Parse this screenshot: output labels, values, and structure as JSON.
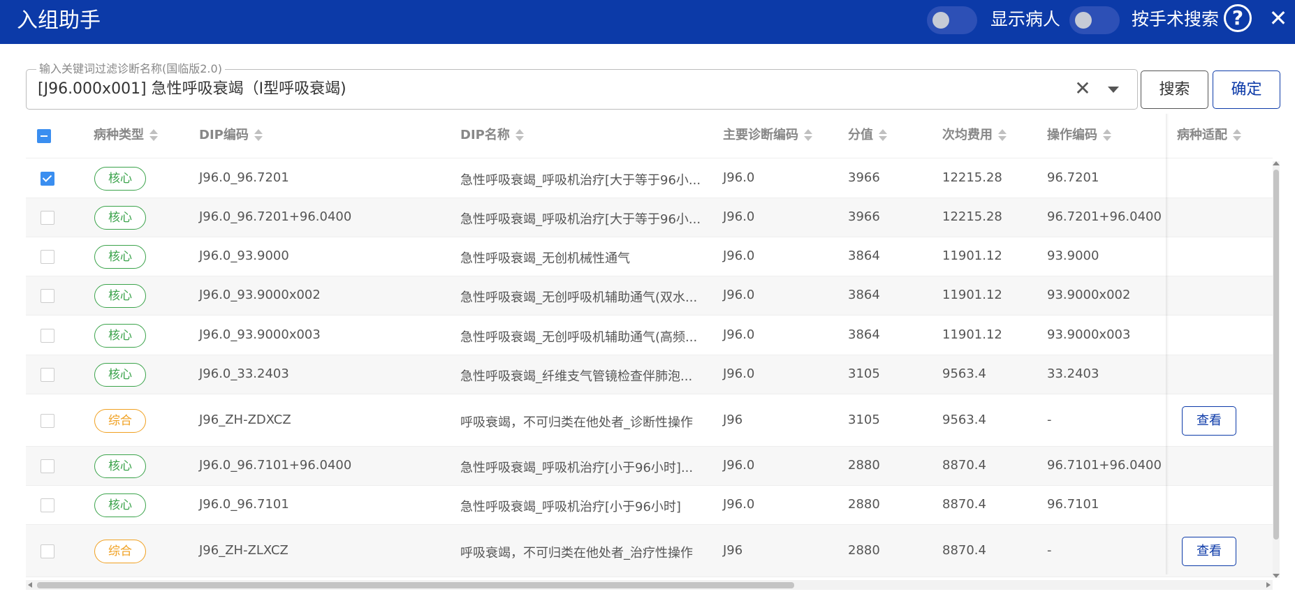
{
  "header": {
    "title": "入组助手",
    "toggle_show_patient_label": "显示病人",
    "toggle_search_by_surgery_label": "按手术搜索",
    "help_icon": "question-circle-icon",
    "close_icon": "close-icon"
  },
  "search": {
    "legend": "输入关键词过滤诊断名称(国临版2.0)",
    "value": "[J96.000x001] 急性呼吸衰竭（I型呼吸衰竭)",
    "search_button": "搜索",
    "confirm_button": "确定"
  },
  "table": {
    "columns": {
      "disease_type": "病种类型",
      "dip_code": "DIP编码",
      "dip_name": "DIP名称",
      "main_diag_code": "主要诊断编码",
      "score": "分值",
      "avg_cost": "次均费用",
      "op_code": "操作编码",
      "match": "病种适配"
    },
    "rows": [
      {
        "tag": "核心",
        "tag_type": "core",
        "checked": true,
        "dip_code": "J96.0_96.7201",
        "dip_name": "急性呼吸衰竭_呼吸机治疗[大于等于96小...",
        "diag": "J96.0",
        "score": "3966",
        "cost": "12215.28",
        "op": "96.7201",
        "view": ""
      },
      {
        "tag": "核心",
        "tag_type": "core",
        "checked": false,
        "dip_code": "J96.0_96.7201+96.0400",
        "dip_name": "急性呼吸衰竭_呼吸机治疗[大于等于96小...",
        "diag": "J96.0",
        "score": "3966",
        "cost": "12215.28",
        "op": "96.7201+96.0400",
        "view": ""
      },
      {
        "tag": "核心",
        "tag_type": "core",
        "checked": false,
        "dip_code": "J96.0_93.9000",
        "dip_name": "急性呼吸衰竭_无创机械性通气",
        "diag": "J96.0",
        "score": "3864",
        "cost": "11901.12",
        "op": "93.9000",
        "view": ""
      },
      {
        "tag": "核心",
        "tag_type": "core",
        "checked": false,
        "dip_code": "J96.0_93.9000x002",
        "dip_name": "急性呼吸衰竭_无创呼吸机辅助通气(双水...",
        "diag": "J96.0",
        "score": "3864",
        "cost": "11901.12",
        "op": "93.9000x002",
        "view": ""
      },
      {
        "tag": "核心",
        "tag_type": "core",
        "checked": false,
        "dip_code": "J96.0_93.9000x003",
        "dip_name": "急性呼吸衰竭_无创呼吸机辅助通气(高频...",
        "diag": "J96.0",
        "score": "3864",
        "cost": "11901.12",
        "op": "93.9000x003",
        "view": ""
      },
      {
        "tag": "核心",
        "tag_type": "core",
        "checked": false,
        "dip_code": "J96.0_33.2403",
        "dip_name": "急性呼吸衰竭_纤维支气管镜检查伴肺泡...",
        "diag": "J96.0",
        "score": "3105",
        "cost": "9563.4",
        "op": "33.2403",
        "view": ""
      },
      {
        "tag": "综合",
        "tag_type": "comp",
        "checked": false,
        "dip_code": "J96_ZH-ZDXCZ",
        "dip_name": "呼吸衰竭，不可归类在他处者_诊断性操作",
        "diag": "J96",
        "score": "3105",
        "cost": "9563.4",
        "op": "-",
        "view": "查看"
      },
      {
        "tag": "核心",
        "tag_type": "core",
        "checked": false,
        "dip_code": "J96.0_96.7101+96.0400",
        "dip_name": "急性呼吸衰竭_呼吸机治疗[小于96小时]...",
        "diag": "J96.0",
        "score": "2880",
        "cost": "8870.4",
        "op": "96.7101+96.0400",
        "view": ""
      },
      {
        "tag": "核心",
        "tag_type": "core",
        "checked": false,
        "dip_code": "J96.0_96.7101",
        "dip_name": "急性呼吸衰竭_呼吸机治疗[小于96小时]",
        "diag": "J96.0",
        "score": "2880",
        "cost": "8870.4",
        "op": "96.7101",
        "view": ""
      },
      {
        "tag": "综合",
        "tag_type": "comp",
        "checked": false,
        "dip_code": "J96_ZH-ZLXCZ",
        "dip_name": "呼吸衰竭，不可归类在他处者_治疗性操作",
        "diag": "J96",
        "score": "2880",
        "cost": "8870.4",
        "op": "-",
        "view": "查看"
      }
    ]
  },
  "colors": {
    "header_bg": "#0c3aa8",
    "core_tag": "#3aa34a",
    "comprehensive_tag": "#f0a020",
    "checkbox_checked": "#3a8ef0"
  }
}
